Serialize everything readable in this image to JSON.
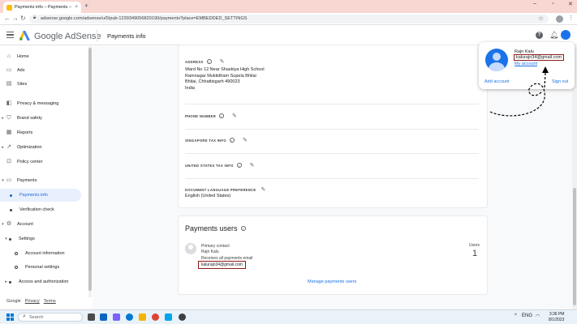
{
  "browser": {
    "tab_title": "Payments info – Payments – G...",
    "tab_close": "×",
    "new_tab": "+",
    "window_controls": [
      "–",
      "▫",
      "✕"
    ],
    "url": "adsense.google.com/adsense/u/0/pub-1239349056820190/payments?place=EMBEDDED_SETTINGS"
  },
  "header": {
    "logo_text": "Google AdSense",
    "page_title": "Payments info"
  },
  "sidebar": {
    "items": [
      {
        "label": "Home",
        "icon": "home-icon"
      },
      {
        "label": "Ads",
        "icon": "ads-icon"
      },
      {
        "label": "Sites",
        "icon": "sites-icon"
      },
      {
        "label": "Privacy & messaging",
        "icon": "privacy-icon"
      },
      {
        "label": "Brand safety",
        "icon": "brand-safety-icon"
      },
      {
        "label": "Reports",
        "icon": "reports-icon"
      },
      {
        "label": "Optimization",
        "icon": "optimization-icon"
      },
      {
        "label": "Policy center",
        "icon": "policy-icon"
      },
      {
        "label": "Payments",
        "icon": "payments-icon"
      },
      {
        "label": "Payments info",
        "active": true
      },
      {
        "label": "Verification check"
      },
      {
        "label": "Account",
        "icon": "account-icon"
      },
      {
        "label": "Settings"
      },
      {
        "label": "Account information"
      },
      {
        "label": "Personal settings"
      },
      {
        "label": "Access and authorization"
      }
    ],
    "footer": [
      "Google",
      "Privacy",
      "Terms"
    ]
  },
  "details": {
    "address_label": "ADDRESS",
    "address_lines": [
      "Ward No 12 Near Shaskiya High School",
      "Ramnagar Muktidham Supela Bhilai",
      "Bhilai, Chhattisgarh 490023",
      "India"
    ],
    "phone_label": "PHONE NUMBER",
    "singapore_label": "SINGAPORE TAX INFO",
    "us_label": "UNITED STATES TAX INFO",
    "language_label": "DOCUMENT LANGUAGE PREFERENCE",
    "language_value": "English (United States)"
  },
  "payments_users": {
    "title": "Payments users",
    "role": "Primary contact",
    "name": "Rajn Kalu",
    "note": "Receives all payments email",
    "email": "kalurajn34@gmail.com",
    "count_label": "Users",
    "count": "1",
    "manage_link": "Manage payments users"
  },
  "account_popup": {
    "name": "Rajn Kalu",
    "email": "kalurajn34@gmail.com",
    "my_account": "My account",
    "add_account": "Add account",
    "sign_out": "Sign out"
  },
  "taskbar": {
    "search_placeholder": "Search",
    "time": "3:36 PM",
    "date": "8/1/2023",
    "lang": "ENG"
  },
  "colors": {
    "accent": "#1a73e8",
    "highlight_box": "#8b1a1a",
    "active_nav_bg": "#e8f0fe"
  }
}
